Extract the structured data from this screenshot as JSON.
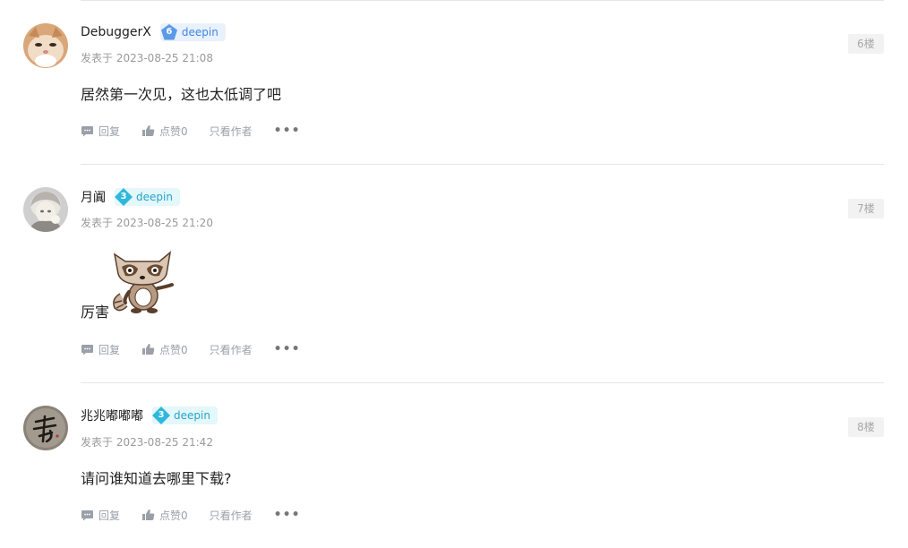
{
  "posts": [
    {
      "username": "DebuggerX",
      "level": "6",
      "badge_text": "deepin",
      "timestamp": "发表于 2023-08-25 21:08",
      "floor": "6楼",
      "content": "居然第一次见，这也太低调了吧",
      "actions": {
        "reply": "回复",
        "like": "点赞0",
        "only_author": "只看作者",
        "more": "•••"
      }
    },
    {
      "username": "月阗",
      "level": "3",
      "badge_text": "deepin",
      "timestamp": "发表于 2023-08-25 21:20",
      "floor": "7楼",
      "content": "厉害",
      "sticker": "raccoon-sticker",
      "actions": {
        "reply": "回复",
        "like": "点赞0",
        "only_author": "只看作者",
        "more": "•••"
      }
    },
    {
      "username": "兆兆嘟嘟嘟",
      "level": "3",
      "badge_text": "deepin",
      "timestamp": "发表于 2023-08-25 21:42",
      "floor": "8楼",
      "content": "请问谁知道去哪里下载?",
      "actions": {
        "reply": "回复",
        "like": "点赞0",
        "only_author": "只看作者",
        "more": "•••"
      }
    }
  ],
  "colors": {
    "badge_lv6": "#5b9ae8",
    "badge_lv3": "#2fb8dc",
    "icon_gray": "#9aa0a8",
    "divider": "#e6e6e6"
  },
  "icons": {
    "reply": "comment-icon",
    "like": "thumbs-up-icon",
    "more": "more-dots-icon"
  }
}
